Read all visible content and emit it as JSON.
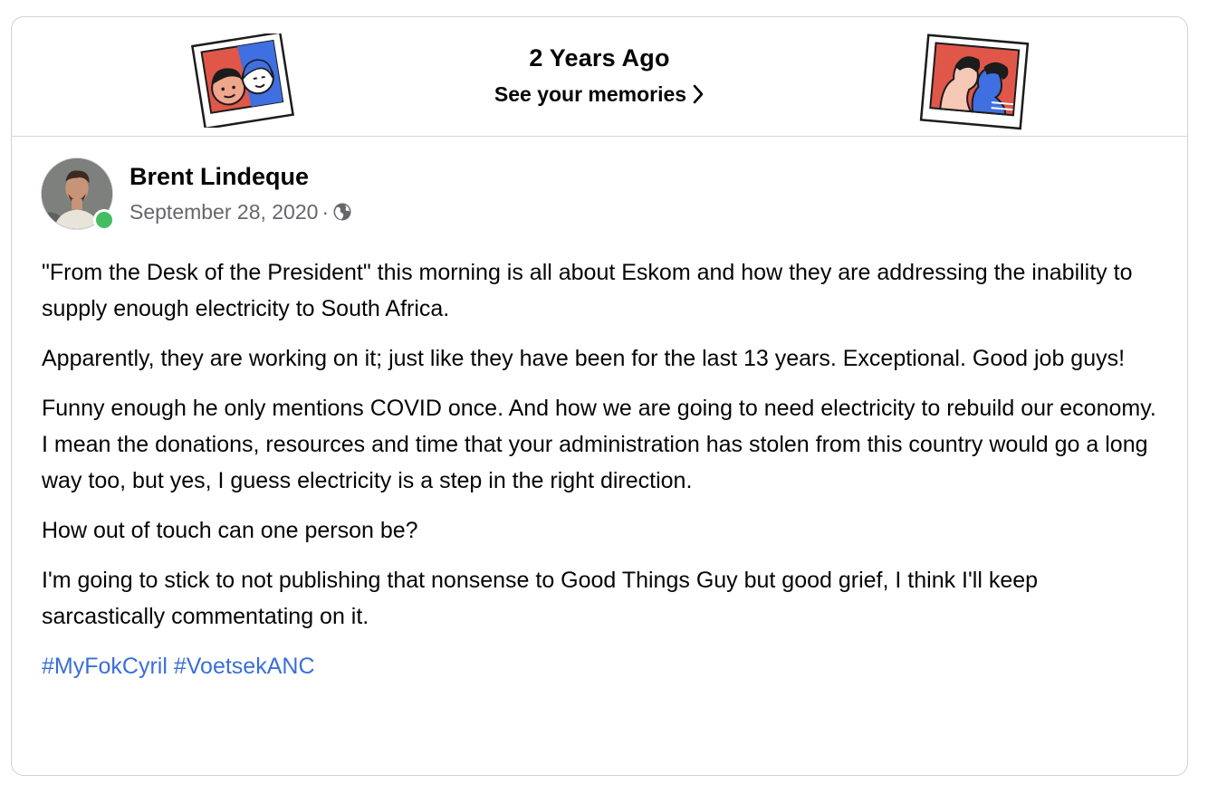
{
  "memories": {
    "title": "2 Years Ago",
    "link_label": "See your memories",
    "icons": [
      "friends-polaroid-icon",
      "kiss-polaroid-icon",
      "chevron-right-icon"
    ]
  },
  "post": {
    "author": "Brent Lindeque",
    "date": "September 28, 2020",
    "separator": "·",
    "audience_icon": "globe-icon",
    "online": true,
    "paragraphs": [
      "\"From the Desk of the President\" this morning is all about Eskom and how they are addressing the inability to supply enough electricity to South Africa.",
      "Apparently, they are working on it; just like they have been for the last 13 years. Exceptional. Good job guys!",
      "Funny enough he only mentions COVID once. And how we are going to need electricity to rebuild our economy. I mean the donations, resources and time that your administration has stolen from this country would go a long way too, but yes, I guess electricity is a step in the right direction.",
      "How out of touch can one person be?",
      "I'm going to stick to not publishing that nonsense to Good Things Guy but good grief, I think I'll keep sarcastically commentating on it."
    ],
    "hashtags": [
      "#MyFokCyril",
      "#VoetsekANC"
    ]
  },
  "colors": {
    "link": "#3a6fd8",
    "meta": "#65676b",
    "online": "#45bd62",
    "border": "#cfd2d6"
  }
}
